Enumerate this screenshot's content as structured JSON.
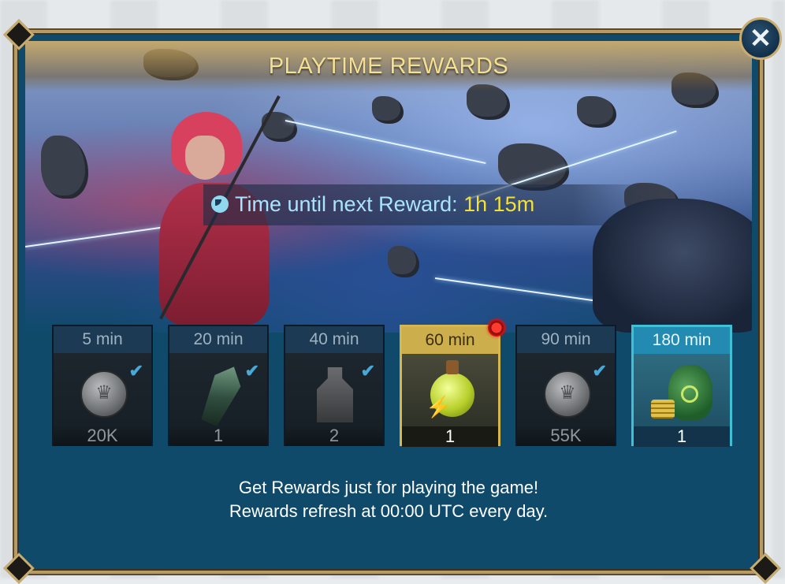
{
  "window": {
    "title": "PLAYTIME REWARDS",
    "close_icon": "close-icon"
  },
  "timer": {
    "label": "Time until next Reward:",
    "value": "1h 15m",
    "icon": "clock-icon"
  },
  "rewards": [
    {
      "time": "5 min",
      "qty": "20K",
      "icon": "silver-coin-icon",
      "state": "claimed"
    },
    {
      "time": "20 min",
      "qty": "1",
      "icon": "shard-icon",
      "state": "claimed"
    },
    {
      "time": "40 min",
      "qty": "2",
      "icon": "bottle-icon",
      "state": "claimed"
    },
    {
      "time": "60 min",
      "qty": "1",
      "icon": "energy-potion-icon",
      "state": "ready"
    },
    {
      "time": "90 min",
      "qty": "55K",
      "icon": "silver-coin-icon",
      "state": "claimed"
    },
    {
      "time": "180 min",
      "qty": "1",
      "icon": "money-bag-icon",
      "state": "next"
    }
  ],
  "footer": {
    "line1": "Get Rewards just for playing the game!",
    "line2": "Rewards refresh at 00:00 UTC every day."
  },
  "colors": {
    "panel": "#0f4a6b",
    "gold": "#f4df92",
    "timer_value": "#f3e033",
    "ready_border": "#d7b64e",
    "next_border": "#3fc0d6"
  }
}
